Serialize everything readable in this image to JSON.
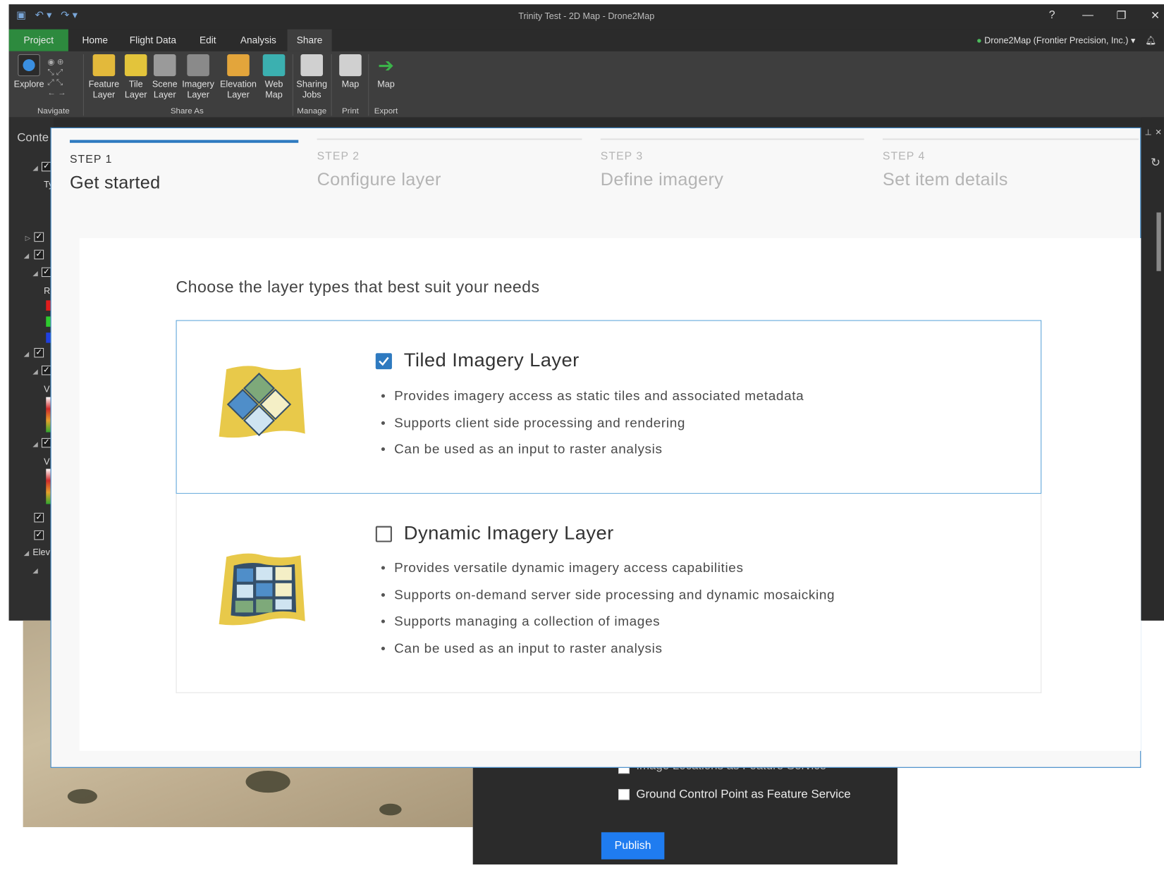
{
  "app": {
    "title": "Trinity Test - 2D Map - Drone2Map",
    "help": "?",
    "user": "Drone2Map (Frontier Precision, Inc.) ▾",
    "tabs": [
      "Project",
      "Home",
      "Flight Data",
      "Edit",
      "Analysis",
      "Share"
    ],
    "active_tab": "Share"
  },
  "ribbon": {
    "explore": "Explore",
    "buttons": [
      {
        "label1": "Feature",
        "label2": "Layer",
        "color": "#e3b93b"
      },
      {
        "label1": "Tile",
        "label2": "Layer",
        "color": "#e3c43b"
      },
      {
        "label1": "Scene",
        "label2": "Layer",
        "color": "#9a9a9a"
      },
      {
        "label1": "Imagery",
        "label2": "Layer",
        "color": "#8a8a8a"
      },
      {
        "label1": "Elevation",
        "label2": "Layer",
        "color": "#e3a53b"
      },
      {
        "label1": "Web",
        "label2": "Map",
        "color": "#3bb0b0"
      },
      {
        "label1": "Sharing",
        "label2": "Jobs",
        "color": "#d0d0d0"
      },
      {
        "label1": "Map",
        "label2": "",
        "color": "#d0d0d0"
      },
      {
        "label1": "Map",
        "label2": "",
        "color": "#3bb34a"
      }
    ],
    "groups": [
      "Navigate",
      "Share As",
      "Manage",
      "Print",
      "Export"
    ]
  },
  "panel": {
    "title": "Conte",
    "row_letters": [
      "Ty",
      "R",
      "V",
      "V"
    ],
    "elev": "Elev"
  },
  "dialog": {
    "steps": [
      {
        "num": "STEP 1",
        "label": "Get started"
      },
      {
        "num": "STEP 2",
        "label": "Configure layer"
      },
      {
        "num": "STEP 3",
        "label": "Define imagery"
      },
      {
        "num": "STEP 4",
        "label": "Set item details"
      }
    ],
    "heading": "Choose the layer types that best suit your needs",
    "options": [
      {
        "title": "Tiled Imagery Layer",
        "checked": true,
        "bullets": [
          "Provides imagery access as static tiles and associated metadata",
          "Supports client side processing and rendering",
          "Can be used as an input to raster analysis"
        ]
      },
      {
        "title": "Dynamic Imagery Layer",
        "checked": false,
        "bullets": [
          "Provides versatile dynamic imagery access capabilities",
          "Supports on-demand server side processing and dynamic mosaicking",
          "Supports managing a collection of images",
          "Can be used as an input to raster analysis"
        ]
      }
    ]
  },
  "bottom_panel": {
    "partial_option": "Image Locations as Feature Service",
    "option": "Ground Control Point as Feature Service",
    "publish": "Publish"
  },
  "colors": {
    "accent": "#2e7ac0",
    "project_tab": "#2d8a3e",
    "publish": "#1f7cf0"
  }
}
